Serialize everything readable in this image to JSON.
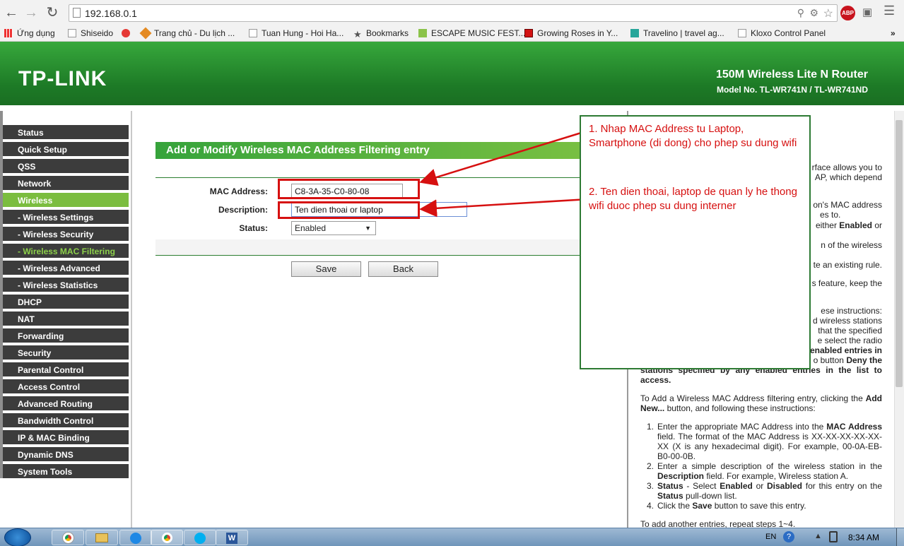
{
  "browser": {
    "url": "192.168.0.1",
    "bookmarks": [
      "Ứng dụng",
      "Shiseido",
      "Trang chủ - Du lịch ...",
      "Tuan Hung - Hoi Ha...",
      "Bookmarks",
      "ESCAPE MUSIC FEST...",
      "Growing Roses in Y...",
      "Travelino | travel ag...",
      "Kloxo Control Panel"
    ],
    "abp_label": "ABP"
  },
  "header": {
    "logo": "TP-LINK",
    "product": "150M Wireless Lite N Router",
    "model": "Model No. TL-WR741N / TL-WR741ND"
  },
  "sidebar": {
    "items": [
      {
        "label": "Status",
        "type": "top"
      },
      {
        "label": "Quick Setup",
        "type": "top"
      },
      {
        "label": "QSS",
        "type": "top"
      },
      {
        "label": "Network",
        "type": "top"
      },
      {
        "label": "Wireless",
        "type": "active"
      },
      {
        "label": "- Wireless Settings",
        "type": "sub"
      },
      {
        "label": "- Wireless Security",
        "type": "sub"
      },
      {
        "label": "- Wireless MAC Filtering",
        "type": "subactive"
      },
      {
        "label": "- Wireless Advanced",
        "type": "sub"
      },
      {
        "label": "- Wireless Statistics",
        "type": "sub"
      },
      {
        "label": "DHCP",
        "type": "top"
      },
      {
        "label": "NAT",
        "type": "top"
      },
      {
        "label": "Forwarding",
        "type": "top"
      },
      {
        "label": "Security",
        "type": "top"
      },
      {
        "label": "Parental Control",
        "type": "top"
      },
      {
        "label": "Access Control",
        "type": "top"
      },
      {
        "label": "Advanced Routing",
        "type": "top"
      },
      {
        "label": "Bandwidth Control",
        "type": "top"
      },
      {
        "label": "IP & MAC Binding",
        "type": "top"
      },
      {
        "label": "Dynamic DNS",
        "type": "top"
      },
      {
        "label": "System Tools",
        "type": "top"
      }
    ]
  },
  "form": {
    "title": "Add or Modify Wireless MAC Address Filtering entry",
    "mac_label": "MAC Address:",
    "mac_value": "C8-3A-35-C0-80-08",
    "desc_label": "Description:",
    "desc_value": "Ten dien thoai or laptop",
    "status_label": "Status:",
    "status_value": "Enabled",
    "save": "Save",
    "back": "Back"
  },
  "help": {
    "frag1": "rface allows you to",
    "frag2": "AP, which depend",
    "frag3": "on's MAC address",
    "frag4": "es to.",
    "frag5a": "either ",
    "frag5b": "Enabled",
    "frag5c": " or",
    "frag6": "n of the wireless",
    "frag7": "te an existing rule.",
    "frag8": "s feature, keep the",
    "frag9": "ese instructions:",
    "frag10": "d wireless stations",
    "frag11": "that the specified",
    "frag12": "e select the radio",
    "frag13": "enabled entries in",
    "frag14a": "o button ",
    "frag14b": "Deny the",
    "frag15": "stations specified by any enabled entries in the list to access.",
    "p1a": "To Add a Wireless MAC Address filtering entry, clicking the ",
    "p1b": "Add New...",
    "p1c": " button, and following these instructions:",
    "s1a": "Enter the appropriate MAC Address into the ",
    "s1b": "MAC Address",
    "s1c": " field. The format of the MAC Address is XX-XX-XX-XX-XX-XX (X is any hexadecimal digit). For example, 00-0A-EB-B0-00-0B.",
    "s2a": "Enter a simple description of the wireless station in the ",
    "s2b": "Description",
    "s2c": " field. For example, Wireless station A.",
    "s3a": "Status",
    "s3b": " - Select ",
    "s3c": "Enabled",
    "s3d": " or ",
    "s3e": "Disabled",
    "s3f": " for this entry on the ",
    "s3g": "Status",
    "s3h": " pull-down list.",
    "s4a": "Click the ",
    "s4b": "Save",
    "s4c": " button to save this entry.",
    "p2": "To add another entries, repeat steps 1~4."
  },
  "annotation": {
    "note1": "1. Nhap MAC Address tu Laptop, Smartphone (di dong) cho phep su dung wifi",
    "note2": "2. Ten dien thoai, laptop de quan ly he thong wifi duoc phep su dung interner"
  },
  "taskbar": {
    "lang": "EN",
    "clock": "8:34 AM"
  }
}
